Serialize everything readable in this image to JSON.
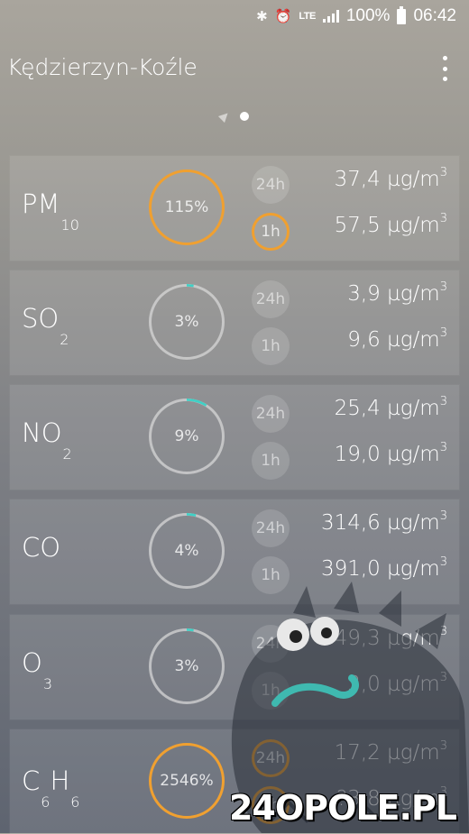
{
  "status_bar": {
    "lte": "LTE",
    "battery": "100%",
    "time": "06:42"
  },
  "app_bar": {
    "title": "Kędzierzyn-Koźle"
  },
  "cards": [
    {
      "name": "PM",
      "sub": "10",
      "percent": "115%",
      "level": 1.15,
      "color": "#f0a030",
      "label_24h": "24h",
      "label_1h": "1h",
      "value_24h": "37,4 µg/m",
      "value_1h": "57,5 µg/m",
      "unit_exp": "3",
      "highlight_24h": false,
      "highlight_1h": true
    },
    {
      "name": "SO",
      "sub": "2",
      "percent": "3%",
      "level": 0.03,
      "color": "#3fd1c6",
      "label_24h": "24h",
      "label_1h": "1h",
      "value_24h": "3,9 µg/m",
      "value_1h": "9,6 µg/m",
      "unit_exp": "3",
      "highlight_24h": false,
      "highlight_1h": false
    },
    {
      "name": "NO",
      "sub": "2",
      "percent": "9%",
      "level": 0.09,
      "color": "#3fd1c6",
      "label_24h": "24h",
      "label_1h": "1h",
      "value_24h": "25,4 µg/m",
      "value_1h": "19,0 µg/m",
      "unit_exp": "3",
      "highlight_24h": false,
      "highlight_1h": false
    },
    {
      "name": "CO",
      "sub": "",
      "percent": "4%",
      "level": 0.04,
      "color": "#3fd1c6",
      "label_24h": "24h",
      "label_1h": "1h",
      "value_24h": "314,6 µg/m",
      "value_1h": "391,0 µg/m",
      "unit_exp": "3",
      "highlight_24h": false,
      "highlight_1h": false
    },
    {
      "name": "O",
      "sub": "3",
      "percent": "3%",
      "level": 0.03,
      "color": "#3fd1c6",
      "label_24h": "24h",
      "label_1h": "1h",
      "value_24h": "49,3 µg/m",
      "value_1h": "3,0 µg/m",
      "unit_exp": "3",
      "highlight_24h": false,
      "highlight_1h": false
    },
    {
      "name": "C6H6",
      "sub": "",
      "percent": "2546%",
      "level": 25.46,
      "color": "#f0a030",
      "label_24h": "24h",
      "label_1h": "1h",
      "value_24h": "17,2 µg/m",
      "value_1h": "?3,8 µg/m",
      "unit_exp": "3",
      "highlight_24h": true,
      "highlight_1h": true
    }
  ],
  "watermark": "24OPOLE.PL",
  "colors": {
    "alert": "#f0a030",
    "ok": "#3fd1c6"
  }
}
